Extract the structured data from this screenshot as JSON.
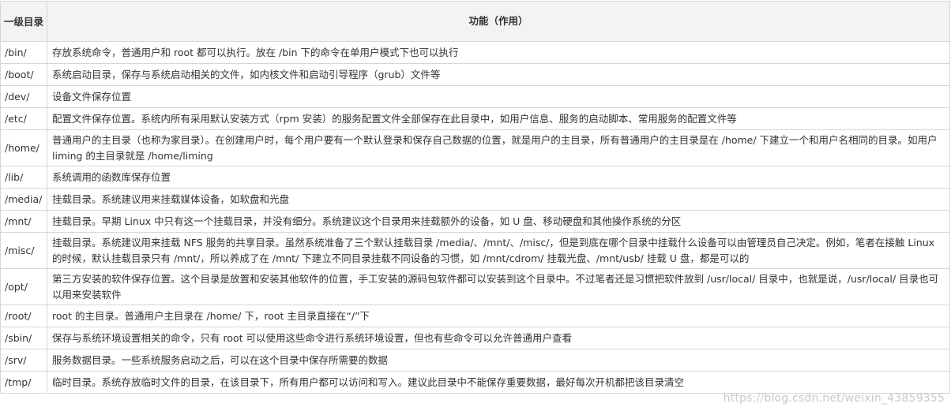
{
  "header": {
    "col1": "一级目录",
    "col2": "功能（作用）"
  },
  "rows": [
    {
      "path": "/bin/",
      "desc": "存放系统命令，普通用户和 root 都可以执行。放在 /bin 下的命令在单用户模式下也可以执行"
    },
    {
      "path": "/boot/",
      "desc": "系统启动目录，保存与系统启动相关的文件，如内核文件和启动引导程序（grub）文件等"
    },
    {
      "path": "/dev/",
      "desc": "设备文件保存位置"
    },
    {
      "path": "/etc/",
      "desc": "配置文件保存位置。系统内所有采用默认安装方式（rpm 安装）的服务配置文件全部保存在此目录中，如用户信息、服务的启动脚本、常用服务的配置文件等"
    },
    {
      "path": "/home/",
      "desc": "普通用户的主目录（也称为家目录）。在创建用户时，每个用户要有一个默认登录和保存自己数据的位置，就是用户的主目录，所有普通用户的主目录是在 /home/ 下建立一个和用户名相同的目录。如用户 liming 的主目录就是 /home/liming"
    },
    {
      "path": "/lib/",
      "desc": "系统调用的函数库保存位置"
    },
    {
      "path": "/media/",
      "desc": "挂载目录。系统建议用来挂载媒体设备，如软盘和光盘"
    },
    {
      "path": "/mnt/",
      "desc": "挂载目录。早期 Linux 中只有这一个挂载目录，并没有细分。系统建议这个目录用来挂载额外的设备，如 U 盘、移动硬盘和其他操作系统的分区"
    },
    {
      "path": "/misc/",
      "desc": "挂载目录。系统建议用来挂载 NFS 服务的共享目录。虽然系统准备了三个默认挂载目录 /media/、/mnt/、/misc/，但是到底在哪个目录中挂载什么设备可以由管理员自己决定。例如，笔者在接触 Linux 的时候，默认挂载目录只有 /mnt/，所以养成了在 /mnt/ 下建立不同目录挂载不同设备的习惯，如 /mnt/cdrom/ 挂载光盘、/mnt/usb/ 挂载 U 盘，都是可以的"
    },
    {
      "path": "/opt/",
      "desc": "第三方安装的软件保存位置。这个目录是放置和安装其他软件的位置，手工安装的源码包软件都可以安装到这个目录中。不过笔者还是习惯把软件放到 /usr/local/ 目录中，也就是说，/usr/local/ 目录也可以用来安装软件"
    },
    {
      "path": "/root/",
      "desc": "root 的主目录。普通用户主目录在 /home/ 下，root 主目录直接在“/”下"
    },
    {
      "path": "/sbin/",
      "desc": "保存与系统环境设置相关的命令，只有 root 可以使用这些命令进行系统环境设置，但也有些命令可以允许普通用户查看"
    },
    {
      "path": "/srv/",
      "desc": "服务数据目录。一些系统服务启动之后，可以在这个目录中保存所需要的数据"
    },
    {
      "path": "/tmp/",
      "desc": "临时目录。系统存放临时文件的目录，在该目录下，所有用户都可以访问和写入。建议此目录中不能保存重要数据，最好每次开机都把该目录清空"
    }
  ],
  "watermark": "https://blog.csdn.net/weixin_43859355"
}
